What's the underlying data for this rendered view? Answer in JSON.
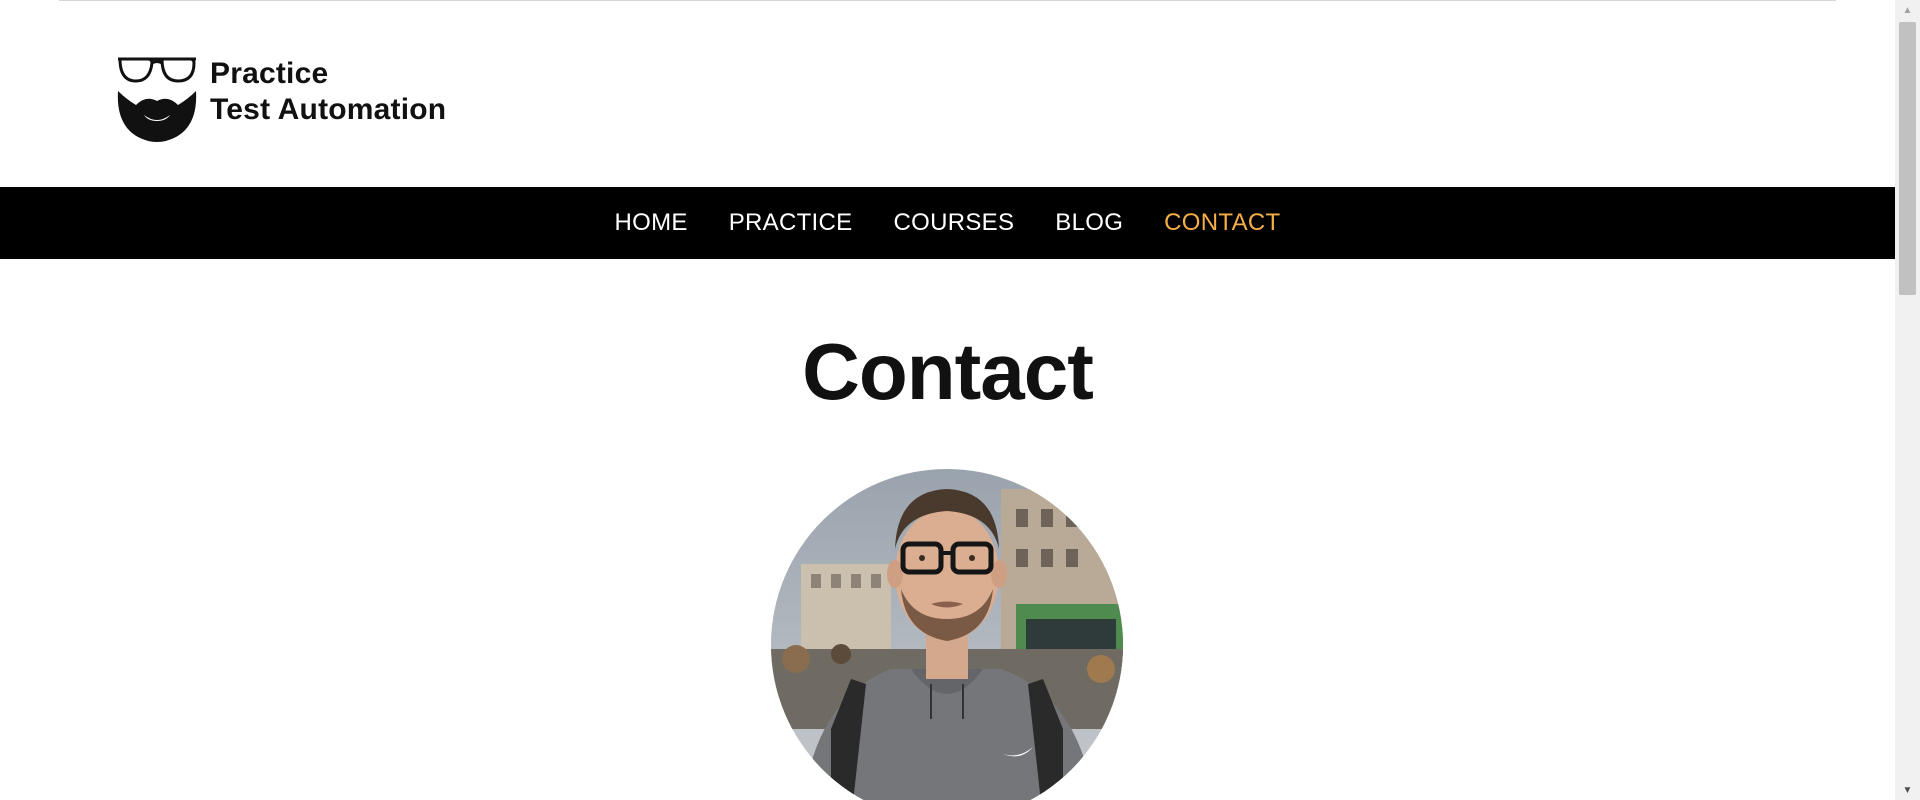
{
  "header": {
    "logo_line1": "Practice",
    "logo_line2": "Test Automation"
  },
  "nav": {
    "items": [
      {
        "label": "HOME"
      },
      {
        "label": "PRACTICE"
      },
      {
        "label": "COURSES"
      },
      {
        "label": "BLOG"
      },
      {
        "label": "CONTACT",
        "active": true
      }
    ],
    "active_color": "#f5ae48"
  },
  "main": {
    "title": "Contact",
    "avatar_icon": "person-photo"
  },
  "scrollbar": {
    "up_icon": "triangle-up-icon",
    "down_icon": "triangle-down-icon"
  }
}
